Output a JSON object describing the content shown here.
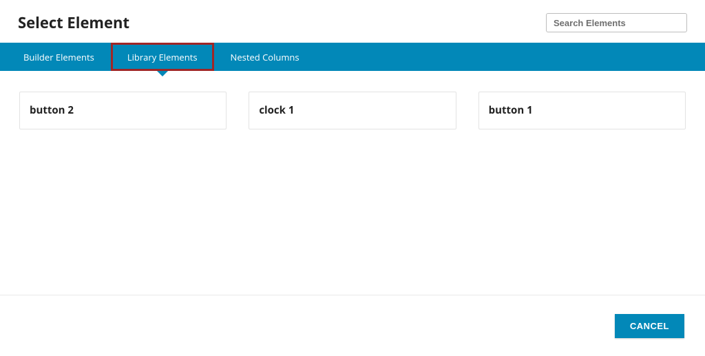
{
  "header": {
    "title": "Select Element",
    "search_placeholder": "Search Elements"
  },
  "tabs": [
    {
      "label": "Builder Elements",
      "active": false
    },
    {
      "label": "Library Elements",
      "active": true
    },
    {
      "label": "Nested Columns",
      "active": false
    }
  ],
  "cards": [
    {
      "label": "button 2"
    },
    {
      "label": "clock 1"
    },
    {
      "label": "button 1"
    }
  ],
  "footer": {
    "cancel_label": "CANCEL"
  },
  "colors": {
    "primary": "#0288b8",
    "highlight_outline": "#a02626"
  }
}
